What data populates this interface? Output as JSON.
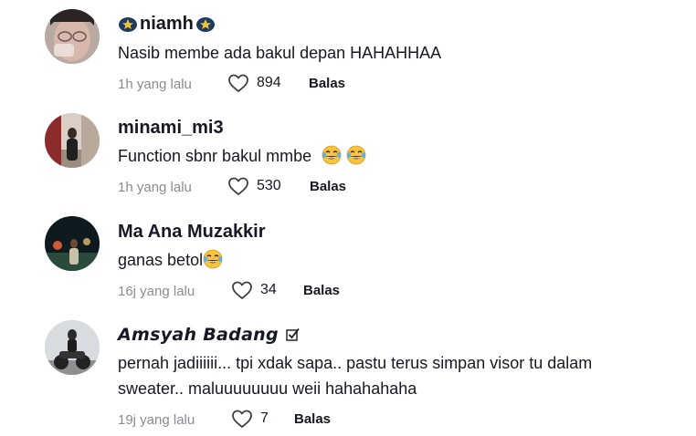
{
  "comments": [
    {
      "username": "niamh",
      "text_lines": [
        "Nasib membe ada bakul depan HAHAHHAA"
      ],
      "time": "1h yang lalu",
      "likes": "894",
      "reply_label": "Balas"
    },
    {
      "username": "minami_mi3",
      "text_lines": [
        "Function sbnr bakul mmbe"
      ],
      "time": "1h yang lalu",
      "likes": "530",
      "reply_label": "Balas"
    },
    {
      "username": "Ma Ana Muzakkir",
      "text_lines": [
        "ganas betol"
      ],
      "time": "16j yang lalu",
      "likes": "34",
      "reply_label": "Balas"
    },
    {
      "username": "𝘼𝙢𝙨𝙮𝙖𝙝 𝘽𝙖𝙙𝙖𝙣𝙜",
      "text_lines": [
        "pernah jadiiiiii... tpi xdak sapa.. pastu terus simpan visor tu dalam",
        "sweater.. maluuuuuuuu weii hahahahaha"
      ],
      "time": "19j yang lalu",
      "likes": "7",
      "reply_label": "Balas"
    }
  ],
  "icons": {
    "like": "heart-outline-icon",
    "laugh_emoji": "tears-of-joy-emoji",
    "badge": "star-badge-icon",
    "check": "checkbox-icon"
  }
}
